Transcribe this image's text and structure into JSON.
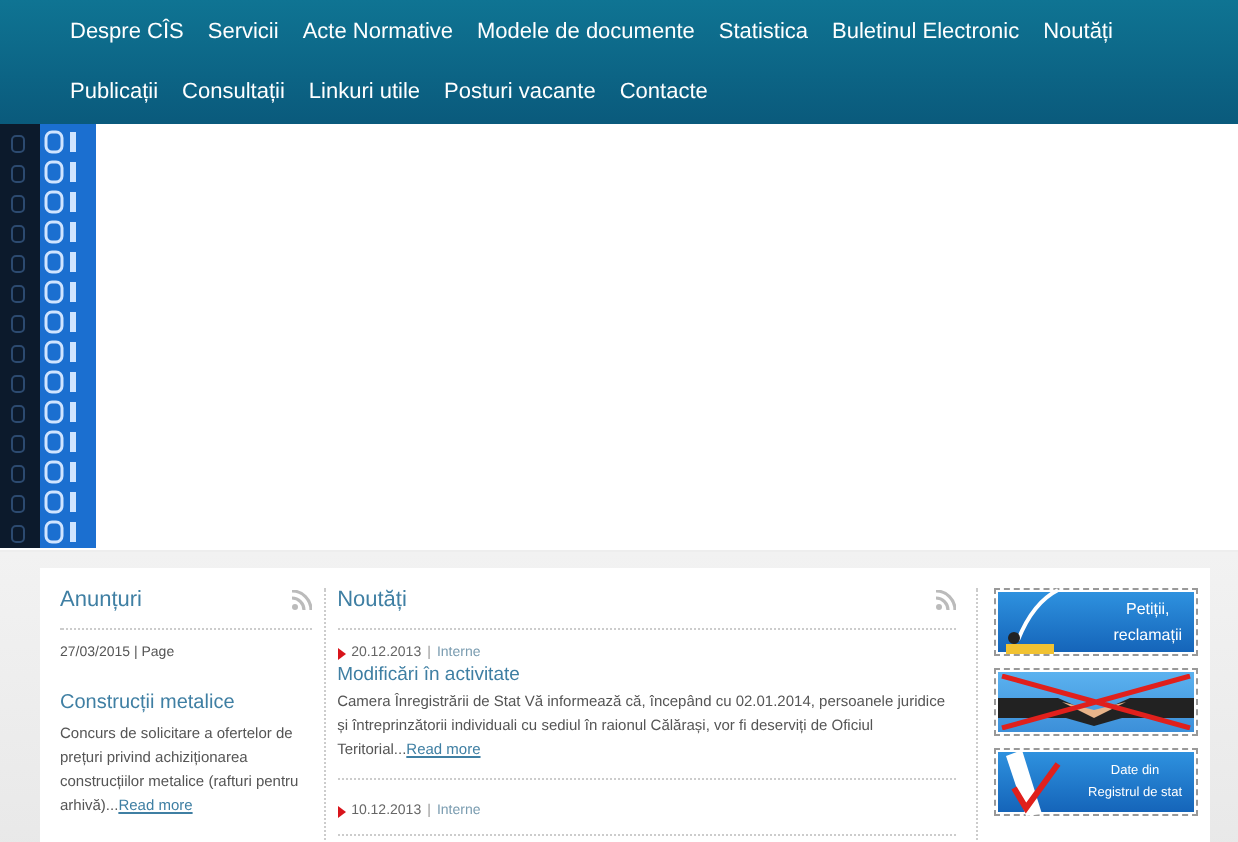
{
  "nav": {
    "items": [
      {
        "label": "Despre CÎS"
      },
      {
        "label": "Servicii"
      },
      {
        "label": "Acte Normative"
      },
      {
        "label": "Modele de documente"
      },
      {
        "label": "Statistica"
      },
      {
        "label": "Buletinul Electronic"
      },
      {
        "label": "Noutăți"
      },
      {
        "label": "Publicații"
      },
      {
        "label": "Consultații"
      },
      {
        "label": "Linkuri utile"
      },
      {
        "label": "Posturi vacante"
      },
      {
        "label": "Contacte"
      }
    ]
  },
  "announcements": {
    "title": "Anunțuri",
    "meta": "27/03/2015 | Page",
    "items": [
      {
        "title": "Construcții metalice",
        "text": "Concurs de solicitare a ofertelor de prețuri privind achiziționarea construcțiilor metalice (rafturi pentru arhivă)...",
        "link": "Read more"
      }
    ]
  },
  "news": {
    "title": "Noutăți",
    "items": [
      {
        "date": "20.12.2013",
        "separator": "|",
        "category": "Interne",
        "title": "Modificări în activitate",
        "text": "Camera Înregistrării de Stat Vă informează că, începând cu 02.01.2014, persoanele juridice și întreprinzătorii individuali cu sediul în raionul Călărași, vor fi deserviți de Oficiul Teritorial...",
        "link": "Read more"
      },
      {
        "date": "10.12.2013",
        "separator": "|",
        "category": "Interne"
      }
    ]
  },
  "banners": [
    {
      "kind": "petitions",
      "lines": [
        "Petiții,",
        "reclamații"
      ]
    },
    {
      "kind": "anticorruption"
    },
    {
      "kind": "registry",
      "lines": [
        "Date din",
        "Registrul de stat"
      ]
    }
  ]
}
